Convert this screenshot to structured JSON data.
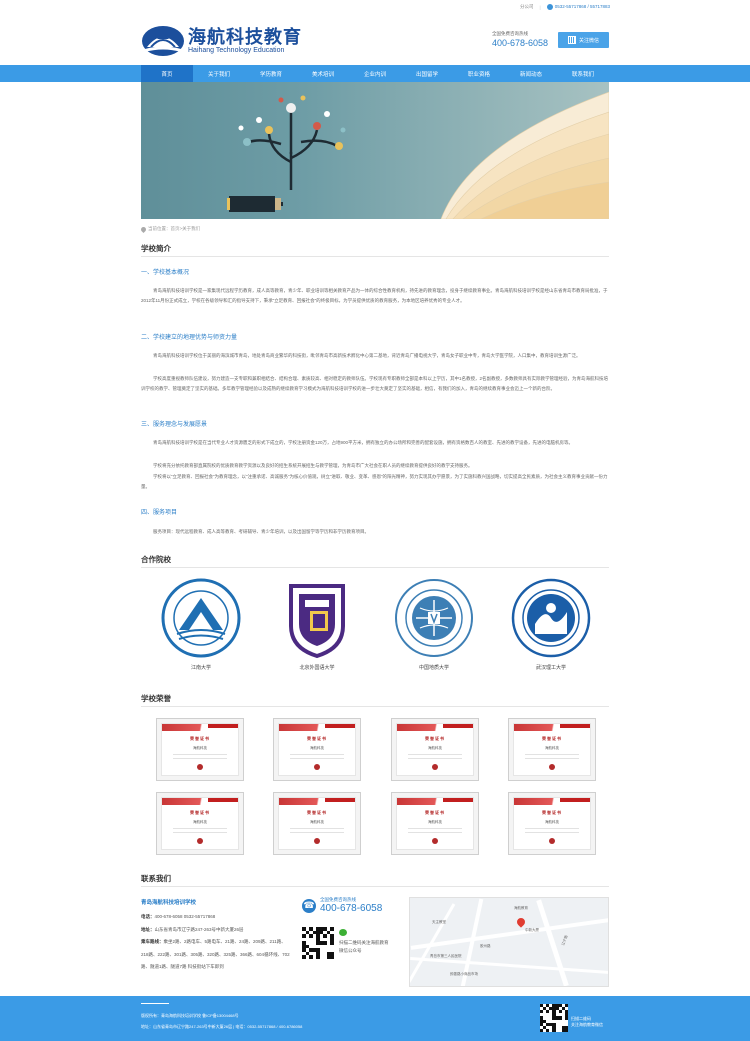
{
  "topbar": {
    "branch": "分公司",
    "phones": "0532-55717868 / 55717883"
  },
  "brand": {
    "name_cn": "海航科技教育",
    "name_en": "Haihang Technology Education"
  },
  "hotline": {
    "label": "全国免费咨询热线",
    "number": "400-678-6058"
  },
  "follow_button": "关注微信",
  "nav": {
    "items": [
      "首页",
      "关于我们",
      "学历教育",
      "美术培训",
      "企业内训",
      "出国留学",
      "职业资格",
      "新闻动态",
      "联系我们"
    ],
    "active_index": 0
  },
  "breadcrumb": "当前位置：首页>关于我们",
  "intro": {
    "title": "学校简介",
    "sections": [
      {
        "heading": "一、学校基本概况",
        "paragraphs": [
          "青岛海航科技培训学校是一家集现代远程学历教育，成人高等教育，青少年、职业培训等相关教育产品为一体的综合性教育机构，持先进的教育理念，投身于继续教育事业。青岛海航科技培训学校是经山东省青岛市教育局批准，于2012年11月份正式成立，学校在各级领导和汇的指导支持下，秉承“立足教育、回报社会”的终极目标，为学员提供优质的教育服务，为本地区培养优秀的专业人才。"
        ]
      },
      {
        "heading": "二、学校建立的地理优势与师资力量",
        "paragraphs": [
          "青岛海航科技培训学校位于美丽的海滨城市青岛，地处青岛商业繁华的科技街，毗邻青岛市高新技术孵化中心第二基地，背近青岛广播电视大学，青岛女子职业中专，青岛大学医学院，人口集中，教育培训生源广泛。",
          "学校高度重视教师队伍建设，努力建造一支专职和兼职相结合、结构合理、素质较高、相对稳定的教师队伍。学校现有专职教师全部是本科以上学历，其中1名教授，2名副教授，多数教师具有实际教学管理经验，为青岛海航科技培训学校的教学、管理奠定了坚实的基础。多年教学管理经验以及成熟的继续教育学习模式为海航科技培训学校的进一步壮大奠定了坚实的基础，相信，有我们的加入，青岛的继续教育事业会迈上一个新的台阶。"
        ]
      },
      {
        "heading": "三、服务理念与发展愿景",
        "paragraphs": [
          "青岛海航科技培训学校是在当代专业人才资源匮乏的形式下成立的，学校注册资金120万，占地900平方米，拥有独立的办公场所和完善的配套设施，拥有资格数百人的教室、先进的教学设备，先进的电脑机房等。",
          "学校将充分依托教育部直属院校的优质教育教学资源以及良好的招生系统开展招生与教学管理，为青岛市广大社会在职人员的继续教育提供良好的教学支持服务。",
          "学校将以“立足教育、回报社会”为教育理念，以“注重承诺、高诚服务”为核心价值观，树立“进取、敬业、变革、感恩”的阳光精神，努力实现其办学愿景，为了实施科教兴国战略，切实提高全民素质，为社会主义教育事业贡献一份力量。"
        ]
      },
      {
        "heading": "四、服务项目",
        "paragraphs": [
          "服务项目：现代远程教育、成人高等教育、考研辅导、青少年培训，以及出国留学等学历和非学历教育项目。"
        ]
      }
    ]
  },
  "partners": {
    "title": "合作院校",
    "items": [
      {
        "name": "江南大学",
        "seal_text": "JIANGNAN UNIVERSITY",
        "color": "#1f6fb3"
      },
      {
        "name": "北京外国语大学",
        "seal_text": "BEIJING FOREIGN STUDIES UNIVERSITY",
        "color": "#4b2a82"
      },
      {
        "name": "中国地质大学",
        "seal_text": "CHINA UNIVERSITY OF GEOSCIENCES",
        "color": "#3d7fb5"
      },
      {
        "name": "武汉理工大学",
        "seal_text": "WUHAN UNIVERSITY OF TECHNOLOGY",
        "color": "#1b5ea8"
      }
    ]
  },
  "honors": {
    "title": "学校荣誉",
    "certificate_title": "荣誉证书",
    "certificate_name": "海航科技",
    "count": 8
  },
  "contact": {
    "title": "联系我们",
    "school": "青岛海航科技培训学校",
    "phone_label": "电话：",
    "phone": "400-678-6058 0532-55717868",
    "address_label": "地址：",
    "address": "山东省青岛市辽宁路247-263号中新大厦26层",
    "bus_label": "乘车路线：",
    "bus": "乘坐2路、2路电车、5路电车、21路、24路、209路、211路、218路、222路、301路、305路、320路、325路、366路、604循环线、702路、隧道1路、隧道7路 科技街站下车即到",
    "hotline_label": "全国免费咨询热线",
    "hotline": "400-678-6058",
    "wechat_text": "扫描二维码关注海航教育微信公众号",
    "map_labels": [
      "海航教育",
      "中新大厦",
      "辽宁路",
      "胶州路",
      "天主教堂",
      "青岛市第三人民医院",
      "即墨路小商品市场"
    ]
  },
  "footer": {
    "line1": "版权所有：青岛海航科技培训学校  鲁ICP备13004468号",
    "line2": "地址：山东省青岛市辽宁路247-263号中新大厦26层 | 电话：0532-55717868 / 400-6786058",
    "wechat_label": "扫描二维码",
    "wechat_desc": "关注海航教育微信"
  },
  "colors": {
    "primary": "#3b9be6",
    "active_nav": "#1f73c8",
    "link_blue": "#2c7fc8",
    "cert_red": "#c21f1f"
  }
}
